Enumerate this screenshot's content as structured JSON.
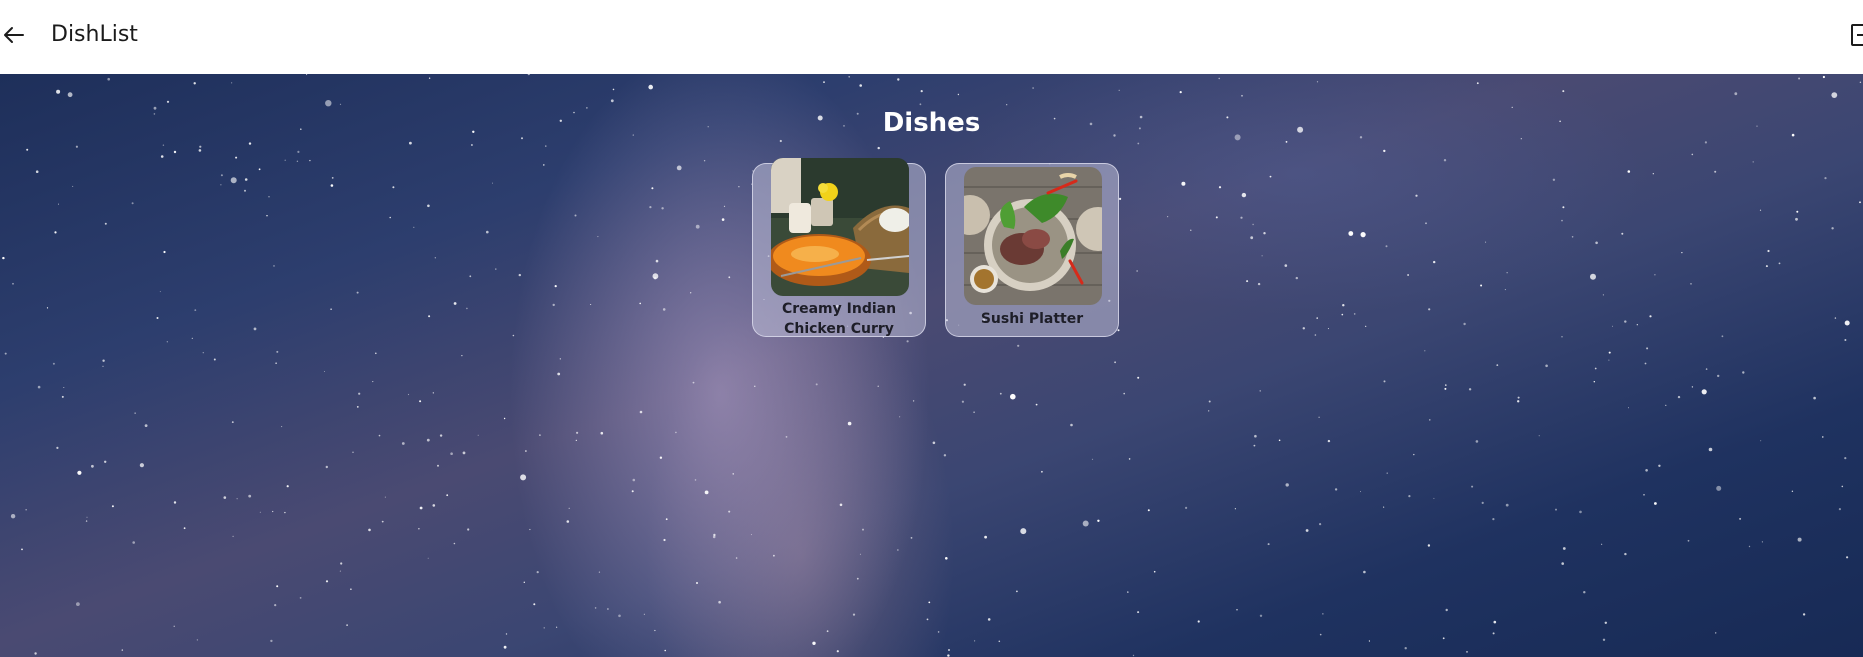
{
  "appbar": {
    "title": "DishList",
    "back_icon": "arrow-left-icon",
    "right_icon": "logout-icon"
  },
  "main": {
    "title": "Dishes",
    "dishes": [
      {
        "name": "Creamy Indian Chicken Curry",
        "image": "curry-photo"
      },
      {
        "name": "Sushi Platter",
        "image": "platter-photo"
      }
    ]
  },
  "colors": {
    "appbar_bg": "#ffffff",
    "text_dark": "#1b1b1b",
    "card_bg": "#bebed7",
    "sky_dark": "#1e2f5a"
  }
}
